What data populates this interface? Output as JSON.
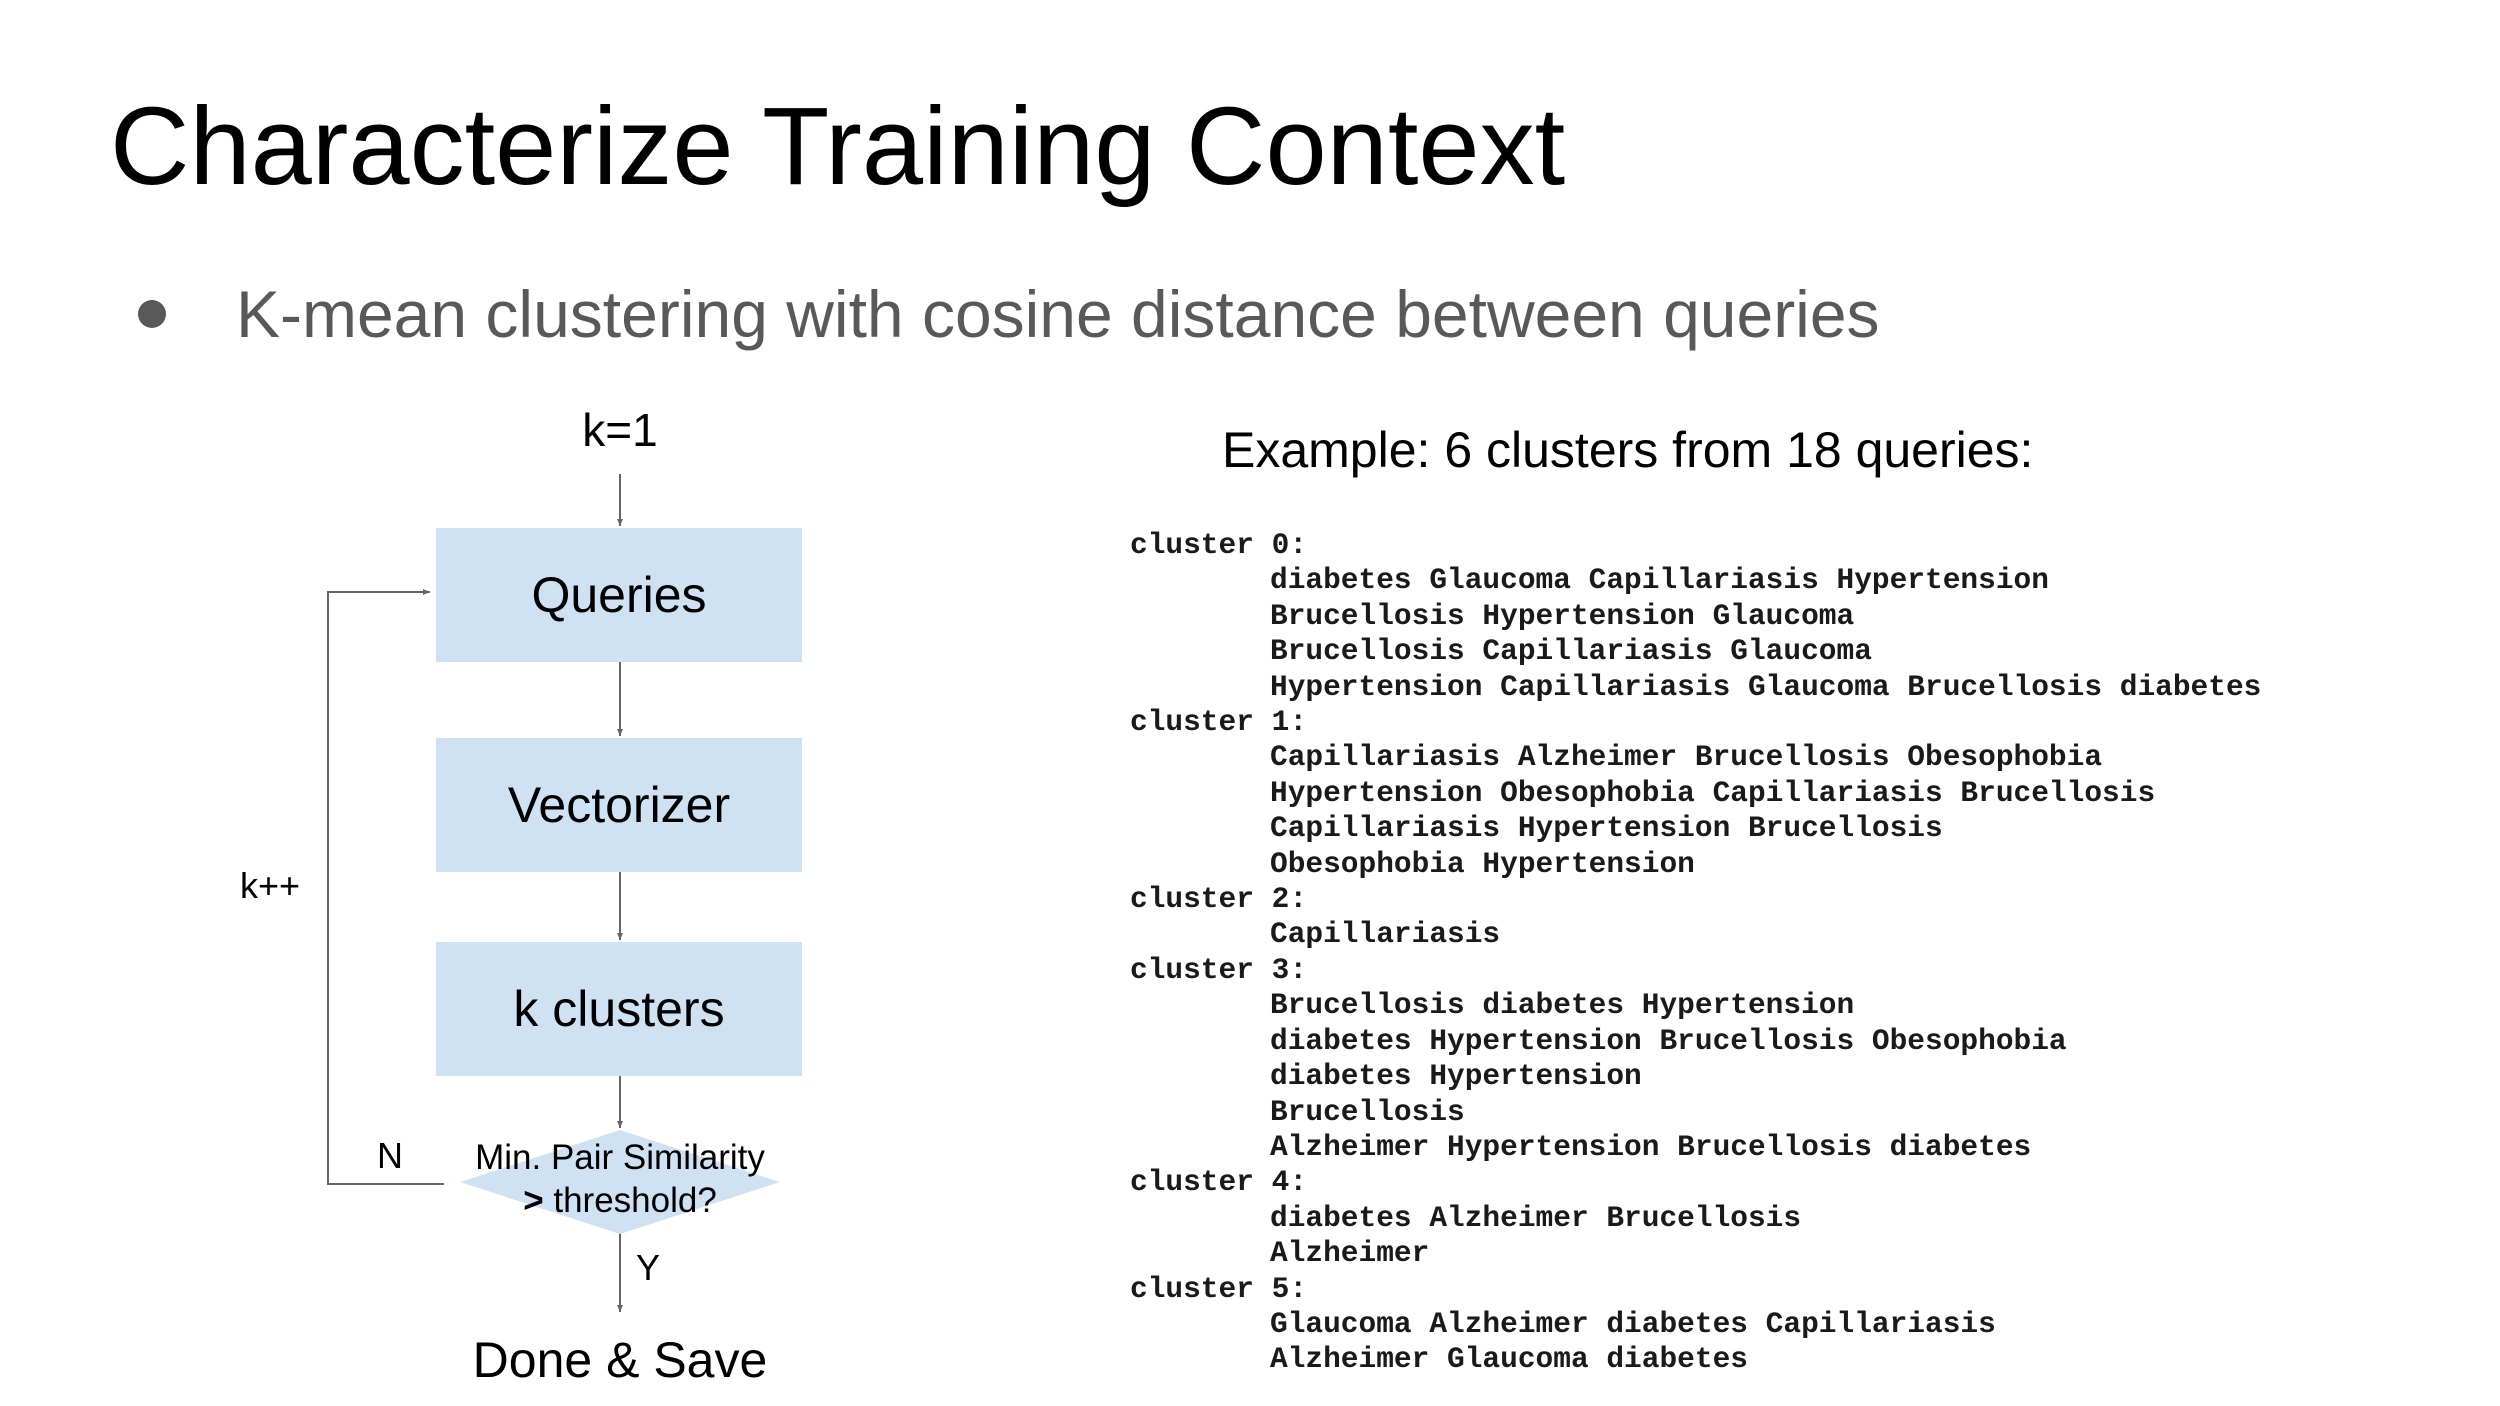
{
  "title": "Characterize Training Context",
  "bullet": "K-mean clustering with cosine distance between queries",
  "flowchart": {
    "start_label": "k=1",
    "boxes": [
      "Queries",
      "Vectorizer",
      "k clusters"
    ],
    "decision_line1": "Min. Pair Similarity",
    "decision_line2_bold": ">",
    "decision_line2_rest": " threshold?",
    "loop_label": "k++",
    "no_label": "N",
    "yes_label": "Y",
    "end_label": "Done & Save"
  },
  "example": {
    "heading": "Example: 6 clusters from 18 queries:",
    "clusters": [
      {
        "label": "cluster 0:",
        "queries": [
          "diabetes Glaucoma Capillariasis Hypertension",
          "Brucellosis Hypertension Glaucoma",
          "Brucellosis Capillariasis Glaucoma",
          "Hypertension Capillariasis Glaucoma Brucellosis diabetes"
        ]
      },
      {
        "label": "cluster 1:",
        "queries": [
          "Capillariasis Alzheimer Brucellosis Obesophobia",
          "Hypertension Obesophobia Capillariasis Brucellosis",
          "Capillariasis Hypertension Brucellosis",
          "Obesophobia Hypertension"
        ]
      },
      {
        "label": "cluster 2:",
        "queries": [
          "Capillariasis"
        ]
      },
      {
        "label": "cluster 3:",
        "queries": [
          "Brucellosis diabetes Hypertension",
          "diabetes Hypertension Brucellosis Obesophobia",
          "diabetes Hypertension",
          "Brucellosis",
          "Alzheimer Hypertension Brucellosis diabetes"
        ]
      },
      {
        "label": "cluster 4:",
        "queries": [
          "diabetes Alzheimer Brucellosis",
          "Alzheimer"
        ]
      },
      {
        "label": "cluster 5:",
        "queries": [
          "Glaucoma Alzheimer diabetes Capillariasis",
          "Alzheimer Glaucoma diabetes"
        ]
      }
    ]
  },
  "colors": {
    "background": "#ffffff",
    "title_text": "#000000",
    "bullet_text": "#595959",
    "box_fill": "#cfe2f3",
    "line": "#666666"
  }
}
